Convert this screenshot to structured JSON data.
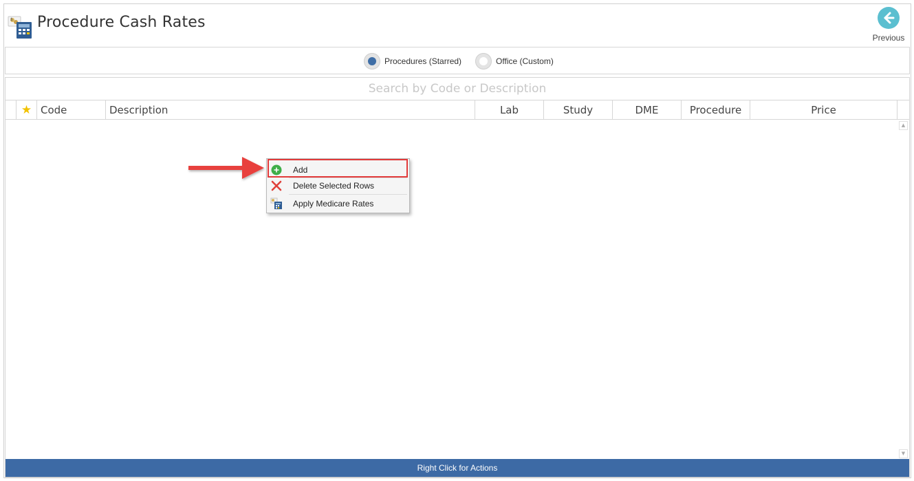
{
  "header": {
    "title": "Procedure Cash Rates",
    "previous_label": "Previous"
  },
  "filter": {
    "options": [
      {
        "label": "Procedures (Starred)",
        "selected": true
      },
      {
        "label": "Office (Custom)",
        "selected": false
      }
    ]
  },
  "grid": {
    "search_placeholder": "Search by Code or Description",
    "columns": {
      "star": "★",
      "code": "Code",
      "description": "Description",
      "lab": "Lab",
      "study": "Study",
      "dme": "DME",
      "procedure": "Procedure",
      "price": "Price"
    },
    "rows": []
  },
  "context_menu": {
    "items": [
      {
        "label": "Add",
        "icon": "add-circle-icon"
      },
      {
        "label": "Delete Selected Rows",
        "icon": "delete-x-icon"
      },
      {
        "label": "Apply Medicare Rates",
        "icon": "medicare-rates-icon"
      }
    ]
  },
  "status_bar": {
    "text": "Right Click for Actions"
  },
  "colors": {
    "accent_blue": "#3d6aa5",
    "previous_button": "#5bbfd0",
    "star": "#f2c200",
    "highlight_red": "#e23a3a",
    "add_green": "#3fae49"
  }
}
